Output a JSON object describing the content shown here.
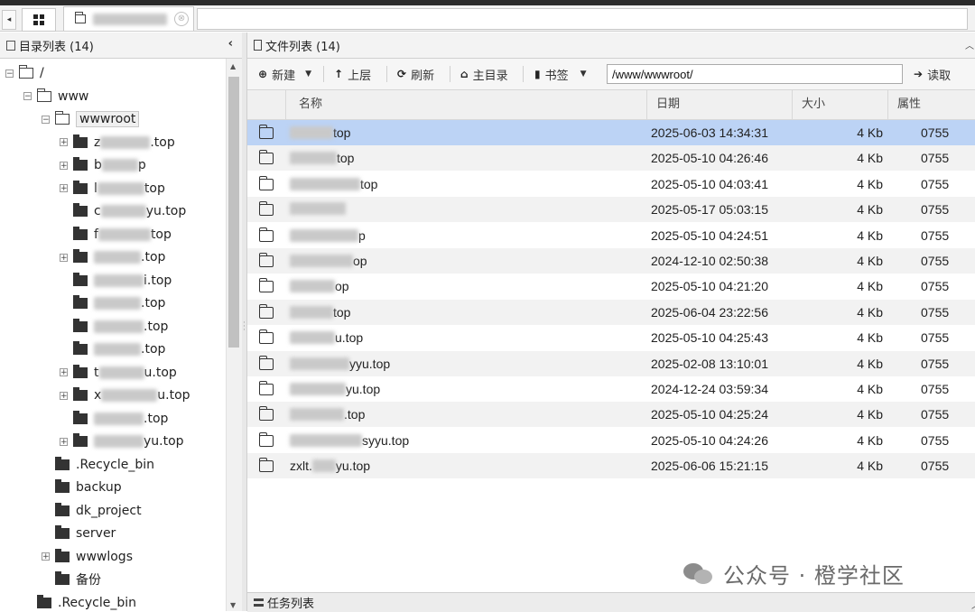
{
  "tabbar": {
    "nav_left": "◂",
    "file_tab_close": "⊗"
  },
  "left_panel": {
    "title": "目录列表 (14)",
    "collapse": "‹",
    "tree": [
      {
        "label": "/",
        "indent": 0,
        "expander": "−",
        "open": true
      },
      {
        "label": "www",
        "indent": 1,
        "expander": "−",
        "open": true
      },
      {
        "label": "wwwroot",
        "indent": 2,
        "expander": "−",
        "open": true,
        "selected": true
      },
      {
        "label": "z        u.top",
        "indent": 3,
        "expander": "+",
        "visible": ".top",
        "prefix": "z"
      },
      {
        "label": "b   y    p",
        "indent": 3,
        "expander": "+",
        "visible": "p",
        "prefix": "b"
      },
      {
        "label": "l        top",
        "indent": 3,
        "expander": "+",
        "visible": "top",
        "prefix": "l"
      },
      {
        "label": "c        yu.top",
        "indent": 3,
        "expander": "",
        "visible": "yu.top",
        "prefix": "c"
      },
      {
        "label": "f        top",
        "indent": 3,
        "expander": "",
        "visible": "top",
        "prefix": "f"
      },
      {
        "label": ".top",
        "indent": 3,
        "expander": "+",
        "visible": ".top",
        "prefix": ""
      },
      {
        "label": "i.top",
        "indent": 3,
        "expander": "",
        "visible": "i.top",
        "prefix": ""
      },
      {
        "label": ".top",
        "indent": 3,
        "expander": "",
        "visible": ".top",
        "prefix": ""
      },
      {
        "label": ".top",
        "indent": 3,
        "expander": "",
        "visible": ".top",
        "prefix": ""
      },
      {
        "label": ".top",
        "indent": 3,
        "expander": "",
        "visible": ".top",
        "prefix": ""
      },
      {
        "label": "t        u.top",
        "indent": 3,
        "expander": "+",
        "visible": "u.top",
        "prefix": "t"
      },
      {
        "label": "x        u.top",
        "indent": 3,
        "expander": "+",
        "visible": "u.top",
        "prefix": "x"
      },
      {
        "label": ".top",
        "indent": 3,
        "expander": "",
        "visible": ".top",
        "prefix": ""
      },
      {
        "label": "yu.top",
        "indent": 3,
        "expander": "+",
        "visible": "yu.top",
        "prefix": ""
      },
      {
        "label": ".Recycle_bin",
        "indent": 2,
        "expander": ""
      },
      {
        "label": "backup",
        "indent": 2,
        "expander": ""
      },
      {
        "label": "dk_project",
        "indent": 2,
        "expander": ""
      },
      {
        "label": "server",
        "indent": 2,
        "expander": ""
      },
      {
        "label": "wwwlogs",
        "indent": 2,
        "expander": "+"
      },
      {
        "label": "备份",
        "indent": 2,
        "expander": ""
      },
      {
        "label": ".Recycle_bin",
        "indent": 1,
        "expander": ""
      }
    ]
  },
  "right_panel": {
    "title": "文件列表 (14)",
    "toolbar": {
      "new": "新建",
      "up": "上层",
      "refresh": "刷新",
      "home": "主目录",
      "bookmark": "书签",
      "path": "/www/wwwroot/",
      "read": "读取"
    },
    "columns": {
      "name": "名称",
      "date": "日期",
      "size": "大小",
      "perm": "属性"
    },
    "files": [
      {
        "name": "top",
        "date": "2025-06-03 14:34:31",
        "size": "4 Kb",
        "perm": "0755",
        "selected": true
      },
      {
        "name": "top",
        "date": "2025-05-10 04:26:46",
        "size": "4 Kb",
        "perm": "0755"
      },
      {
        "name": "top",
        "date": "2025-05-10 04:03:41",
        "size": "4 Kb",
        "perm": "0755"
      },
      {
        "name": "",
        "date": "2025-05-17 05:03:15",
        "size": "4 Kb",
        "perm": "0755"
      },
      {
        "name": "p",
        "date": "2025-05-10 04:24:51",
        "size": "4 Kb",
        "perm": "0755"
      },
      {
        "name": "op",
        "date": "2024-12-10 02:50:38",
        "size": "4 Kb",
        "perm": "0755"
      },
      {
        "name": "op",
        "date": "2025-05-10 04:21:20",
        "size": "4 Kb",
        "perm": "0755"
      },
      {
        "name": "top",
        "date": "2025-06-04 23:22:56",
        "size": "4 Kb",
        "perm": "0755"
      },
      {
        "name": "u.top",
        "date": "2025-05-10 04:25:43",
        "size": "4 Kb",
        "perm": "0755"
      },
      {
        "name": "yyu.top",
        "date": "2025-02-08 13:10:01",
        "size": "4 Kb",
        "perm": "0755"
      },
      {
        "name": "yu.top",
        "date": "2024-12-24 03:59:34",
        "size": "4 Kb",
        "perm": "0755"
      },
      {
        "name": ".top",
        "date": "2025-05-10 04:25:24",
        "size": "4 Kb",
        "perm": "0755"
      },
      {
        "name": "syyu.top",
        "date": "2025-05-10 04:24:26",
        "size": "4 Kb",
        "perm": "0755"
      },
      {
        "name": "zxlt.   yu.top",
        "date": "2025-06-06 15:21:15",
        "size": "4 Kb",
        "perm": "0755"
      }
    ]
  },
  "task_panel": {
    "title": "任务列表"
  },
  "watermark": "公众号 · 橙学社区"
}
